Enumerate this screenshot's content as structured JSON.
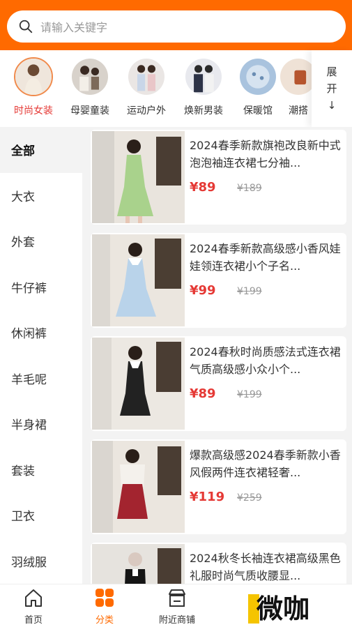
{
  "search": {
    "placeholder": "请输入关键字"
  },
  "categories": [
    {
      "label": "时尚女装",
      "active": true
    },
    {
      "label": "母婴童装",
      "active": false
    },
    {
      "label": "运动户外",
      "active": false
    },
    {
      "label": "焕新男装",
      "active": false
    },
    {
      "label": "保暖馆",
      "active": false
    },
    {
      "label": "潮搭",
      "active": false
    }
  ],
  "expand": {
    "line1": "展",
    "line2": "开",
    "arrow": "↓"
  },
  "sidebar": [
    {
      "label": "全部",
      "active": true
    },
    {
      "label": "大衣"
    },
    {
      "label": "外套"
    },
    {
      "label": "牛仔裤"
    },
    {
      "label": "休闲裤"
    },
    {
      "label": "羊毛呢"
    },
    {
      "label": "半身裙"
    },
    {
      "label": "套装"
    },
    {
      "label": "卫衣"
    },
    {
      "label": "羽绒服"
    }
  ],
  "products": [
    {
      "title": "2024春季新款旗袍改良新中式泡泡袖连衣裙七分袖...",
      "price": "¥89",
      "original_price": "¥189",
      "dress_color": "#a9d28c"
    },
    {
      "title": "2024春季新款高级感小香风娃娃领连衣裙小个子名...",
      "price": "¥99",
      "original_price": "¥199",
      "dress_color": "#b9d3ea"
    },
    {
      "title": "2024春秋时尚质感法式连衣裙气质高级感小众小个...",
      "price": "¥89",
      "original_price": "¥199",
      "dress_color": "#222222"
    },
    {
      "title": "爆款高级感2024春季新款小香风假两件连衣裙轻奢...",
      "price": "¥119",
      "original_price": "¥259",
      "dress_color": "#a3242f"
    },
    {
      "title": "2024秋冬长袖连衣裙高级黑色礼服时尚气质收腰显...",
      "price": "",
      "original_price": "",
      "dress_color": "#151515"
    }
  ],
  "tabbar": [
    {
      "label": "首页",
      "icon": "home-icon",
      "active": false
    },
    {
      "label": "分类",
      "icon": "grid-icon",
      "active": true
    },
    {
      "label": "附近商铺",
      "icon": "store-icon",
      "active": false
    }
  ],
  "watermark": {
    "text": "微咖"
  },
  "colors": {
    "brand": "#ff6a00",
    "price": "#e53935",
    "accent_tab": "#ff6a00"
  }
}
